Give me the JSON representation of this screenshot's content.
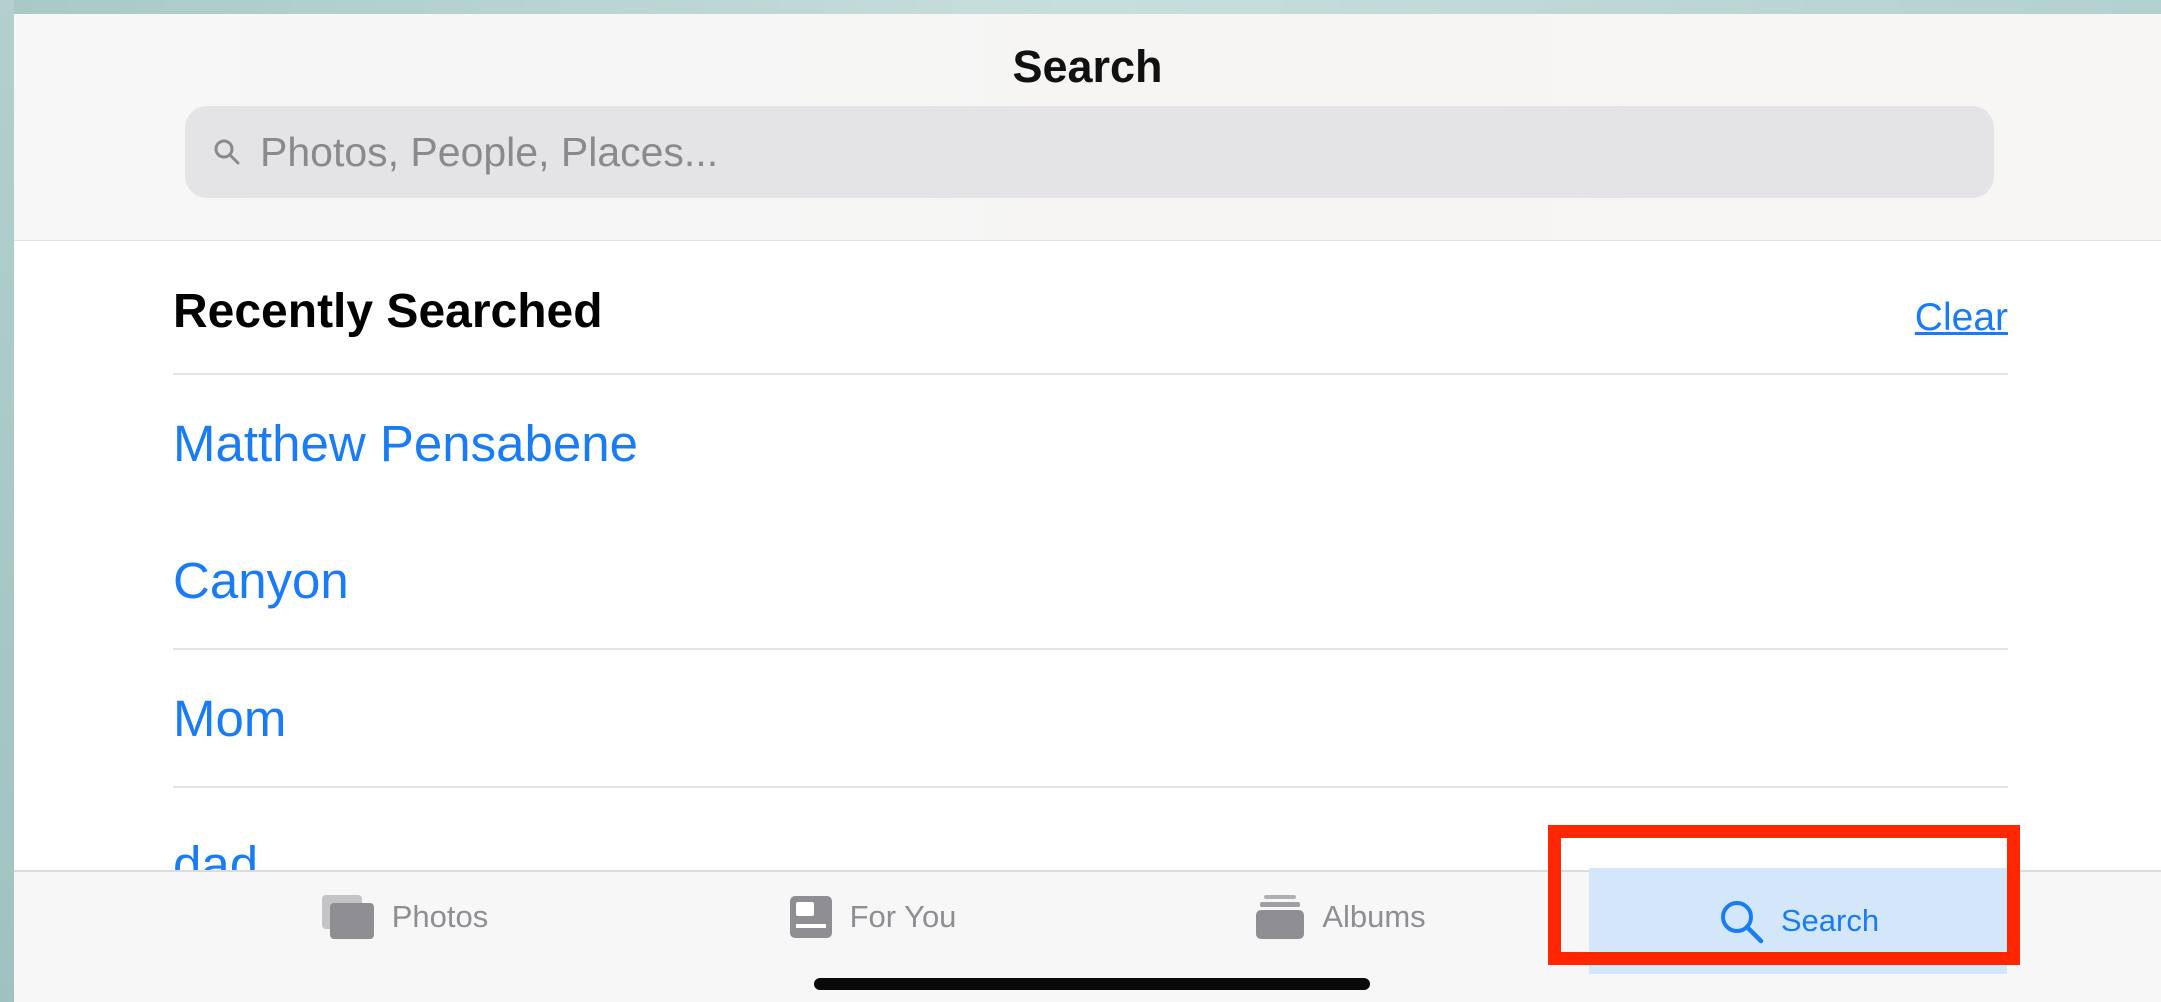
{
  "header": {
    "title": "Search"
  },
  "search": {
    "placeholder": "Photos, People, Places..."
  },
  "recent": {
    "title": "Recently Searched",
    "clear_label": "Clear",
    "items": [
      {
        "label": "Matthew Pensabene"
      },
      {
        "label": "Canyon"
      },
      {
        "label": "Mom"
      },
      {
        "label": "dad"
      }
    ]
  },
  "tabbar": {
    "tabs": [
      {
        "label": "Photos",
        "icon": "photos-icon"
      },
      {
        "label": "For You",
        "icon": "for-you-icon"
      },
      {
        "label": "Albums",
        "icon": "albums-icon"
      },
      {
        "label": "Search",
        "icon": "search-icon",
        "selected": true
      }
    ]
  },
  "colors": {
    "accent": "#1a7cf5",
    "highlight": "#ff2600",
    "selected_tab_bg": "#d4e6fa"
  }
}
